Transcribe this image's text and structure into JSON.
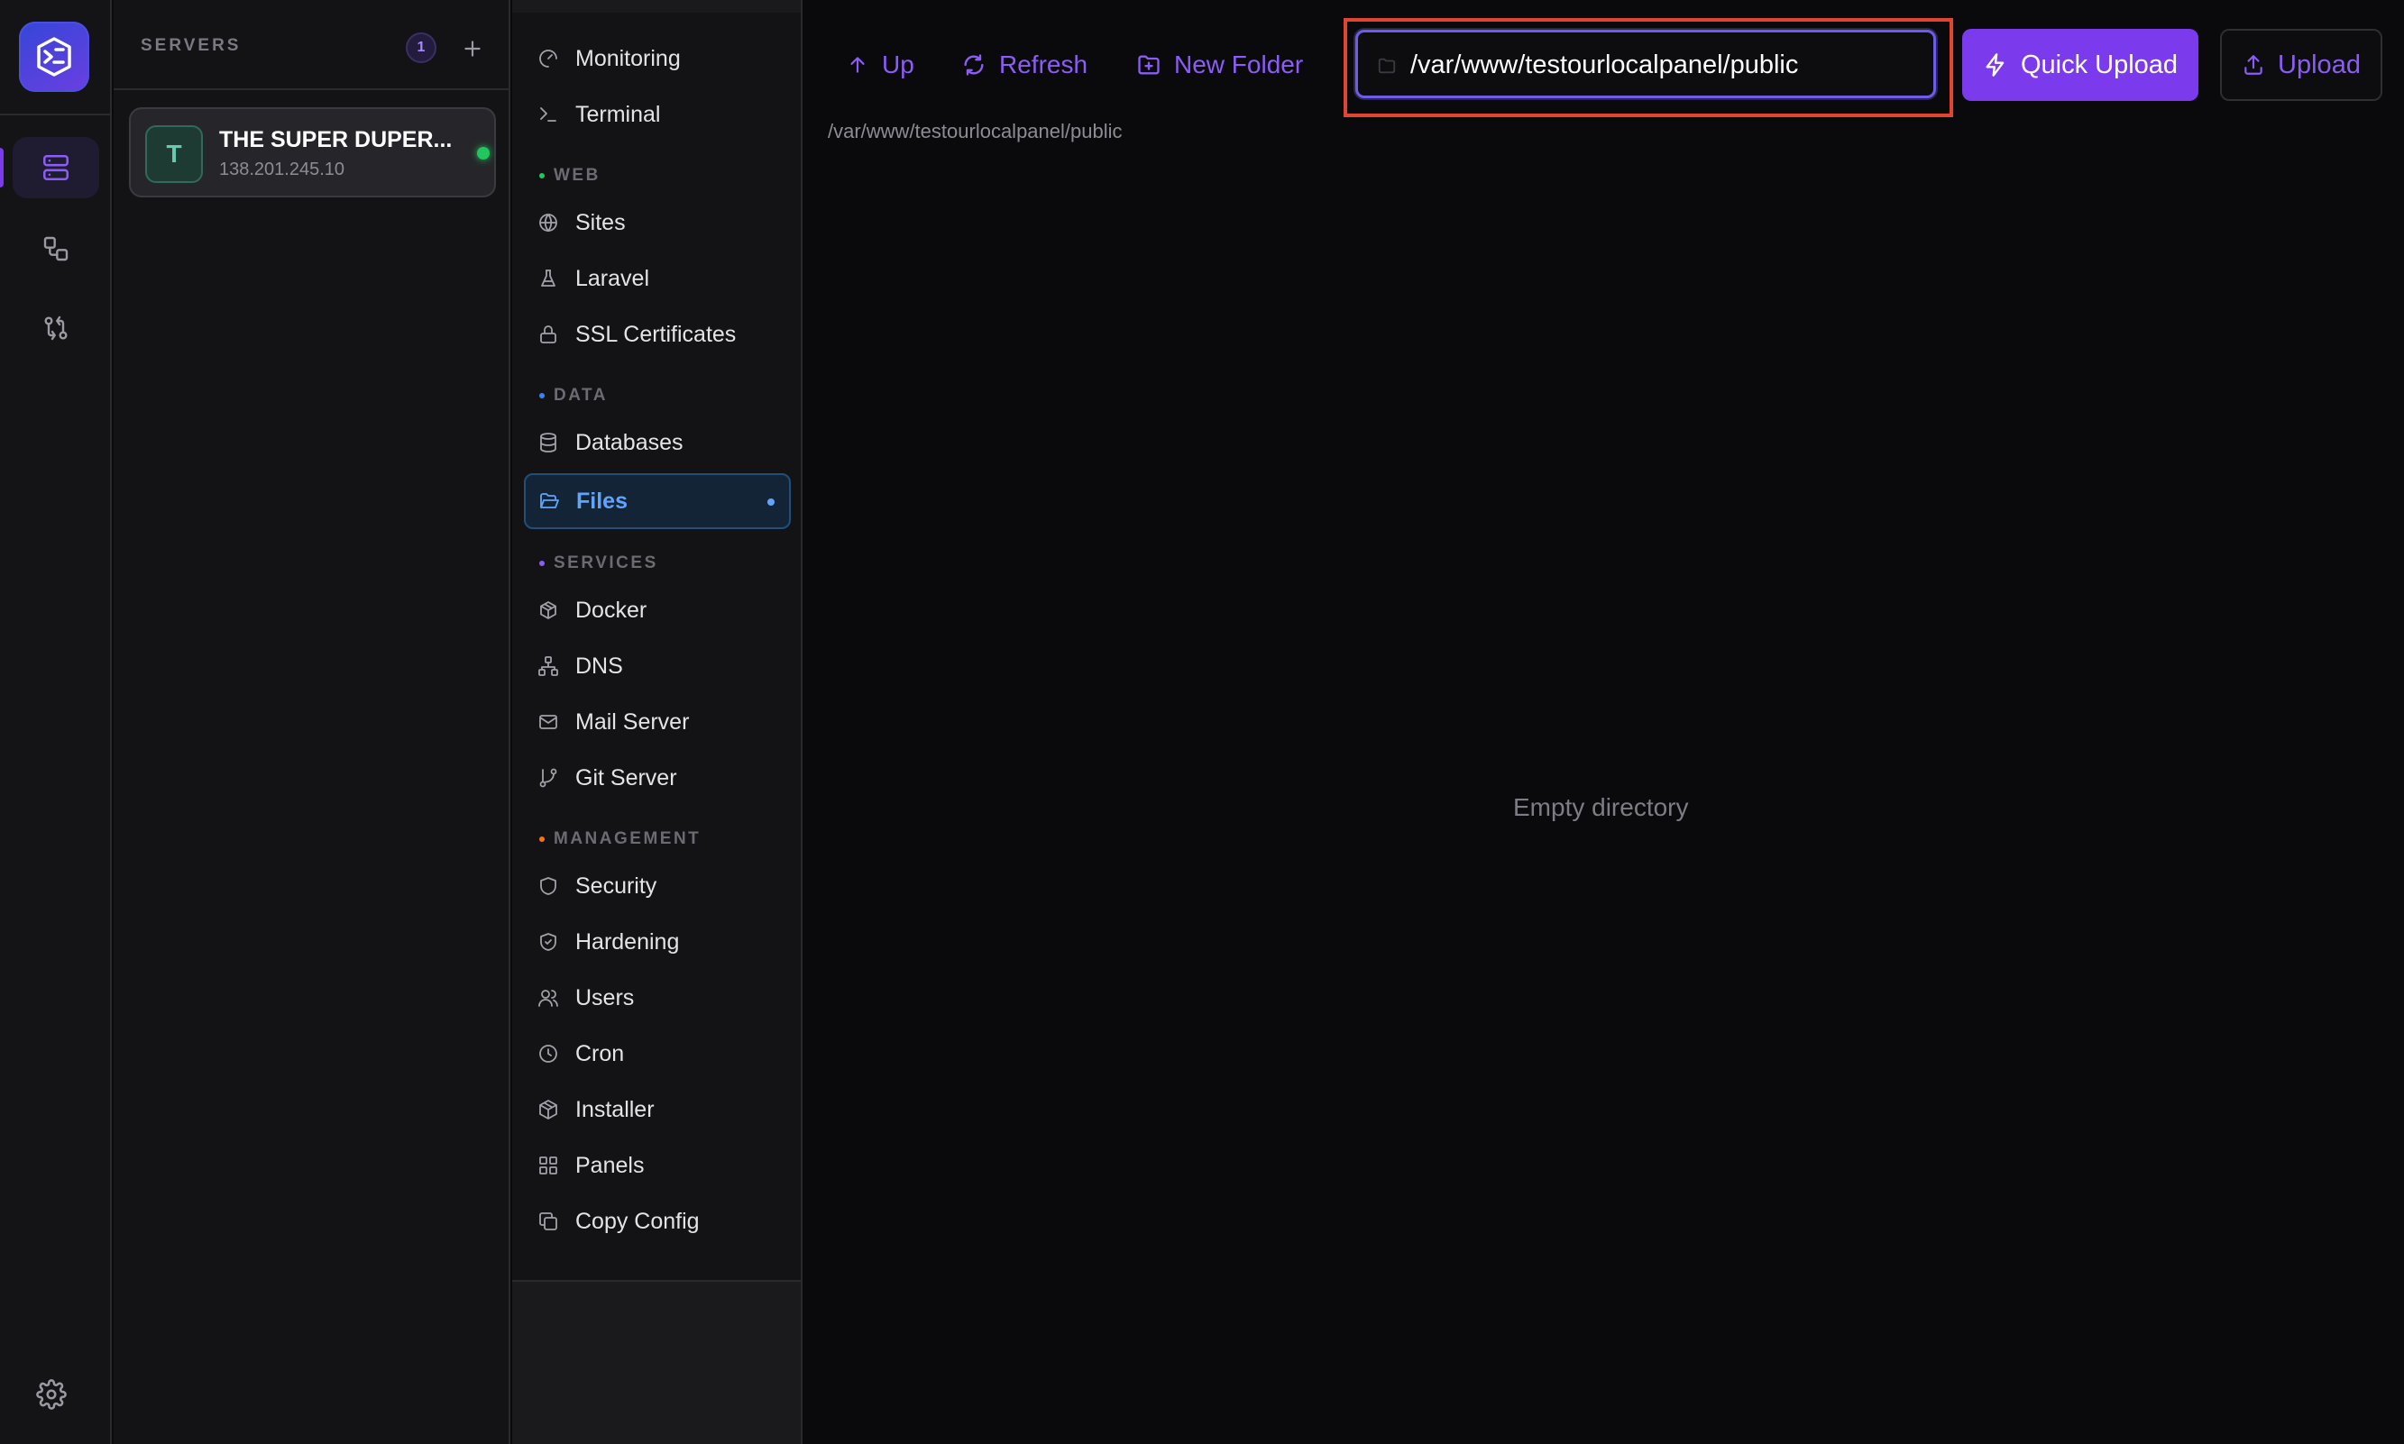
{
  "rail": {
    "logo_icon": "app-logo-icon",
    "items": [
      {
        "name": "servers",
        "icon": "server-stack-icon",
        "active": true
      },
      {
        "name": "workflows",
        "icon": "nodes-icon",
        "active": false
      },
      {
        "name": "sync",
        "icon": "git-compare-icon",
        "active": false
      }
    ],
    "settings_icon": "gear-icon"
  },
  "servers": {
    "title": "SERVERS",
    "count": "1",
    "add_icon": "plus-icon",
    "list": [
      {
        "initial": "T",
        "name": "THE SUPER DUPER...",
        "ip": "138.201.245.10",
        "status": "online"
      }
    ]
  },
  "nav": {
    "items_top": [
      {
        "label": "Monitoring",
        "icon": "gauge-icon"
      },
      {
        "label": "Terminal",
        "icon": "terminal-icon"
      }
    ],
    "sections": [
      {
        "title": "WEB",
        "color": "#22c55e",
        "items": [
          {
            "label": "Sites",
            "icon": "globe-icon"
          },
          {
            "label": "Laravel",
            "icon": "flask-icon"
          },
          {
            "label": "SSL Certificates",
            "icon": "lock-icon"
          }
        ]
      },
      {
        "title": "DATA",
        "color": "#3b82f6",
        "items": [
          {
            "label": "Databases",
            "icon": "database-icon"
          },
          {
            "label": "Files",
            "icon": "folder-open-icon",
            "active": true
          }
        ]
      },
      {
        "title": "SERVICES",
        "color": "#8b5cf6",
        "items": [
          {
            "label": "Docker",
            "icon": "package-icon"
          },
          {
            "label": "DNS",
            "icon": "network-icon"
          },
          {
            "label": "Mail Server",
            "icon": "mail-icon"
          },
          {
            "label": "Git Server",
            "icon": "git-branch-icon"
          }
        ]
      },
      {
        "title": "MANAGEMENT",
        "color": "#f97316",
        "items": [
          {
            "label": "Security",
            "icon": "shield-icon"
          },
          {
            "label": "Hardening",
            "icon": "shield-check-icon"
          },
          {
            "label": "Users",
            "icon": "users-icon"
          },
          {
            "label": "Cron",
            "icon": "clock-icon"
          },
          {
            "label": "Installer",
            "icon": "boxes-icon"
          },
          {
            "label": "Panels",
            "icon": "grid-icon"
          },
          {
            "label": "Copy Config",
            "icon": "copy-icon"
          }
        ]
      }
    ]
  },
  "toolbar": {
    "up_label": "Up",
    "refresh_label": "Refresh",
    "new_folder_label": "New Folder",
    "path_value": "/var/www/testourlocalpanel/public",
    "quick_upload_label": "Quick Upload",
    "upload_label": "Upload"
  },
  "main": {
    "breadcrumb": "/var/www/testourlocalpanel/public",
    "empty_text": "Empty directory"
  },
  "colors": {
    "accent": "#7c3aed",
    "active_nav": "#60a5fa",
    "highlight": "#e0452e",
    "status_online": "#22c55e"
  }
}
